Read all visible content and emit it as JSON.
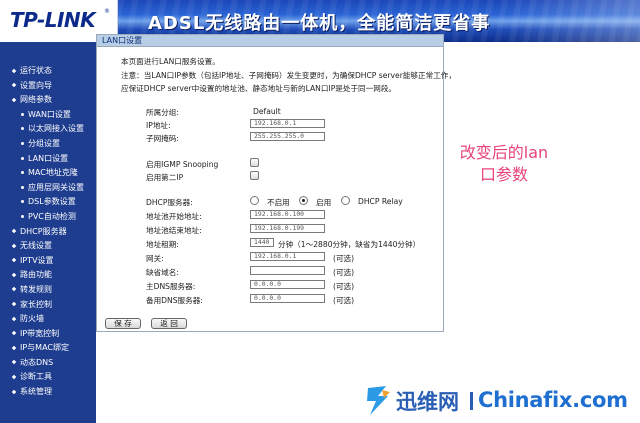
{
  "header": {
    "logo": "TP-LINK",
    "logo_reg": "®",
    "banner_text": "ADSL无线路由一体机，全能简洁更省事"
  },
  "sidebar": {
    "items": [
      {
        "label": "运行状态",
        "level": 0
      },
      {
        "label": "设置向导",
        "level": 0
      },
      {
        "label": "网络参数",
        "level": 0
      },
      {
        "label": "WAN口设置",
        "level": 1
      },
      {
        "label": "以太网接入设置",
        "level": 1
      },
      {
        "label": "分组设置",
        "level": 1
      },
      {
        "label": "LAN口设置",
        "level": 1
      },
      {
        "label": "MAC地址克隆",
        "level": 1
      },
      {
        "label": "应用层网关设置",
        "level": 1
      },
      {
        "label": "DSL参数设置",
        "level": 1
      },
      {
        "label": "PVC自动检测",
        "level": 1
      },
      {
        "label": "DHCP服务器",
        "level": 0
      },
      {
        "label": "无线设置",
        "level": 0
      },
      {
        "label": "IPTV设置",
        "level": 0
      },
      {
        "label": "路由功能",
        "level": 0
      },
      {
        "label": "转发规则",
        "level": 0
      },
      {
        "label": "家长控制",
        "level": 0
      },
      {
        "label": "防火墙",
        "level": 0
      },
      {
        "label": "IP带宽控制",
        "level": 0
      },
      {
        "label": "IP与MAC绑定",
        "level": 0
      },
      {
        "label": "动态DNS",
        "level": 0
      },
      {
        "label": "诊断工具",
        "level": 0
      },
      {
        "label": "系统管理",
        "level": 0
      }
    ]
  },
  "panel": {
    "title": "LAN口设置",
    "intro": "本页面进行LAN口服务设置。",
    "note_line1": "注意：当LAN口IP参数（包括IP地址、子网掩码）发生变更时，为确保DHCP server能够正常工作，",
    "note_line2": "应保证DHCP server中设置的地址池、静态地址与新的LAN口IP是处于同一网段。",
    "group_label": "所属分组:",
    "group_value": "Default",
    "ip_label": "IP地址:",
    "ip_value": "192.168.0.1",
    "mask_label": "子网掩码:",
    "mask_value": "255.255.255.0",
    "igmp_label": "启用IGMP Snooping",
    "second_ip_label": "启用第二IP",
    "dhcp_label": "DHCP服务器:",
    "dhcp_options": [
      "不启用",
      "启用",
      "DHCP Relay"
    ],
    "dhcp_selected": "启用",
    "pool_start_label": "地址池开始地址:",
    "pool_start_value": "192.168.0.100",
    "pool_end_label": "地址池结束地址:",
    "pool_end_value": "192.168.0.199",
    "lease_label": "地址租期:",
    "lease_value": "1440",
    "lease_hint": "分钟（1～2880分钟，缺省为1440分钟）",
    "gateway_label": "网关:",
    "gateway_value": "192.168.0.1",
    "domain_label": "缺省域名:",
    "domain_value": "",
    "dns1_label": "主DNS服务器:",
    "dns1_value": "0.0.0.0",
    "dns2_label": "备用DNS服务器:",
    "dns2_value": "0.0.0.0",
    "optional": "(可选)",
    "save_label": "保 存",
    "back_label": "返 回"
  },
  "annotation": {
    "line1": "改变后的lan",
    "line2": "口参数"
  },
  "watermark": {
    "cn": "迅维网",
    "en": "Chinafix.com"
  },
  "colors": {
    "sidebar_bg": "#1e3d8f",
    "header_bg": "#0a1f6a",
    "panel_title_bg": "#b8cde6",
    "annotation": "#e8447a",
    "watermark_blue": "#2b5fb5"
  }
}
